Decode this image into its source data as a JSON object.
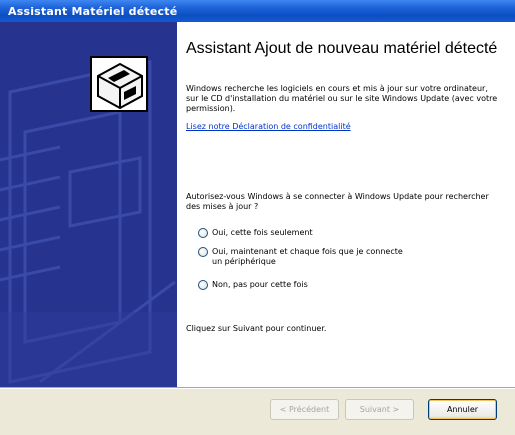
{
  "window": {
    "title": "Assistant Matériel détecté"
  },
  "main": {
    "heading": "Assistant Ajout de nouveau matériel détecté",
    "paragraph1": "Windows recherche les logiciels en cours et mis à jour sur votre ordinateur, sur le CD d'installation du matériel ou sur le site Windows Update (avec votre permission).",
    "privacy_link": "Lisez notre Déclaration de confidentialité",
    "question": "Autorisez-vous Windows à se connecter à Windows Update pour rechercher des mises à jour ?",
    "options": [
      {
        "label": "Oui, cette fois seulement",
        "selected": false
      },
      {
        "label": "Oui, maintenant et chaque fois que je connecte un périphérique",
        "selected": false
      },
      {
        "label": "Non, pas pour cette fois",
        "selected": false
      }
    ],
    "continue_text": "Cliquez sur Suivant pour continuer."
  },
  "buttons": {
    "back": "< Précédent",
    "next": "Suivant >",
    "cancel": "Annuler"
  },
  "colors": {
    "titlebar": "#0b4fc4",
    "side_panel": "#27348f",
    "link": "#0033cc"
  }
}
